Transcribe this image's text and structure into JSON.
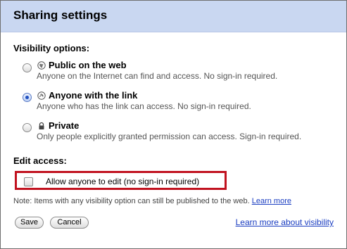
{
  "dialog": {
    "title": "Sharing settings"
  },
  "visibility": {
    "label": "Visibility options:",
    "selected": "link",
    "options": [
      {
        "id": "public",
        "icon": "globe-icon",
        "title": "Public on the web",
        "description": "Anyone on the Internet can find and access. No sign-in required."
      },
      {
        "id": "link",
        "icon": "link-icon",
        "title": "Anyone with the link",
        "description": "Anyone who has the link can access. No sign-in required."
      },
      {
        "id": "private",
        "icon": "lock-icon",
        "title": "Private",
        "description": "Only people explicitly granted permission can access. Sign-in required."
      }
    ]
  },
  "edit_access": {
    "label": "Edit access:",
    "checkbox_label": "Allow anyone to edit (no sign-in required)",
    "checked": false,
    "highlight_color": "#c1121f"
  },
  "note": {
    "text": "Note: Items with any visibility option can still be published to the web.",
    "link": "Learn more"
  },
  "buttons": {
    "save": "Save",
    "cancel": "Cancel"
  },
  "footer_link": "Learn more about visibility",
  "colors": {
    "title_bar": "#c9d7f1",
    "link": "#1a3dc1"
  }
}
